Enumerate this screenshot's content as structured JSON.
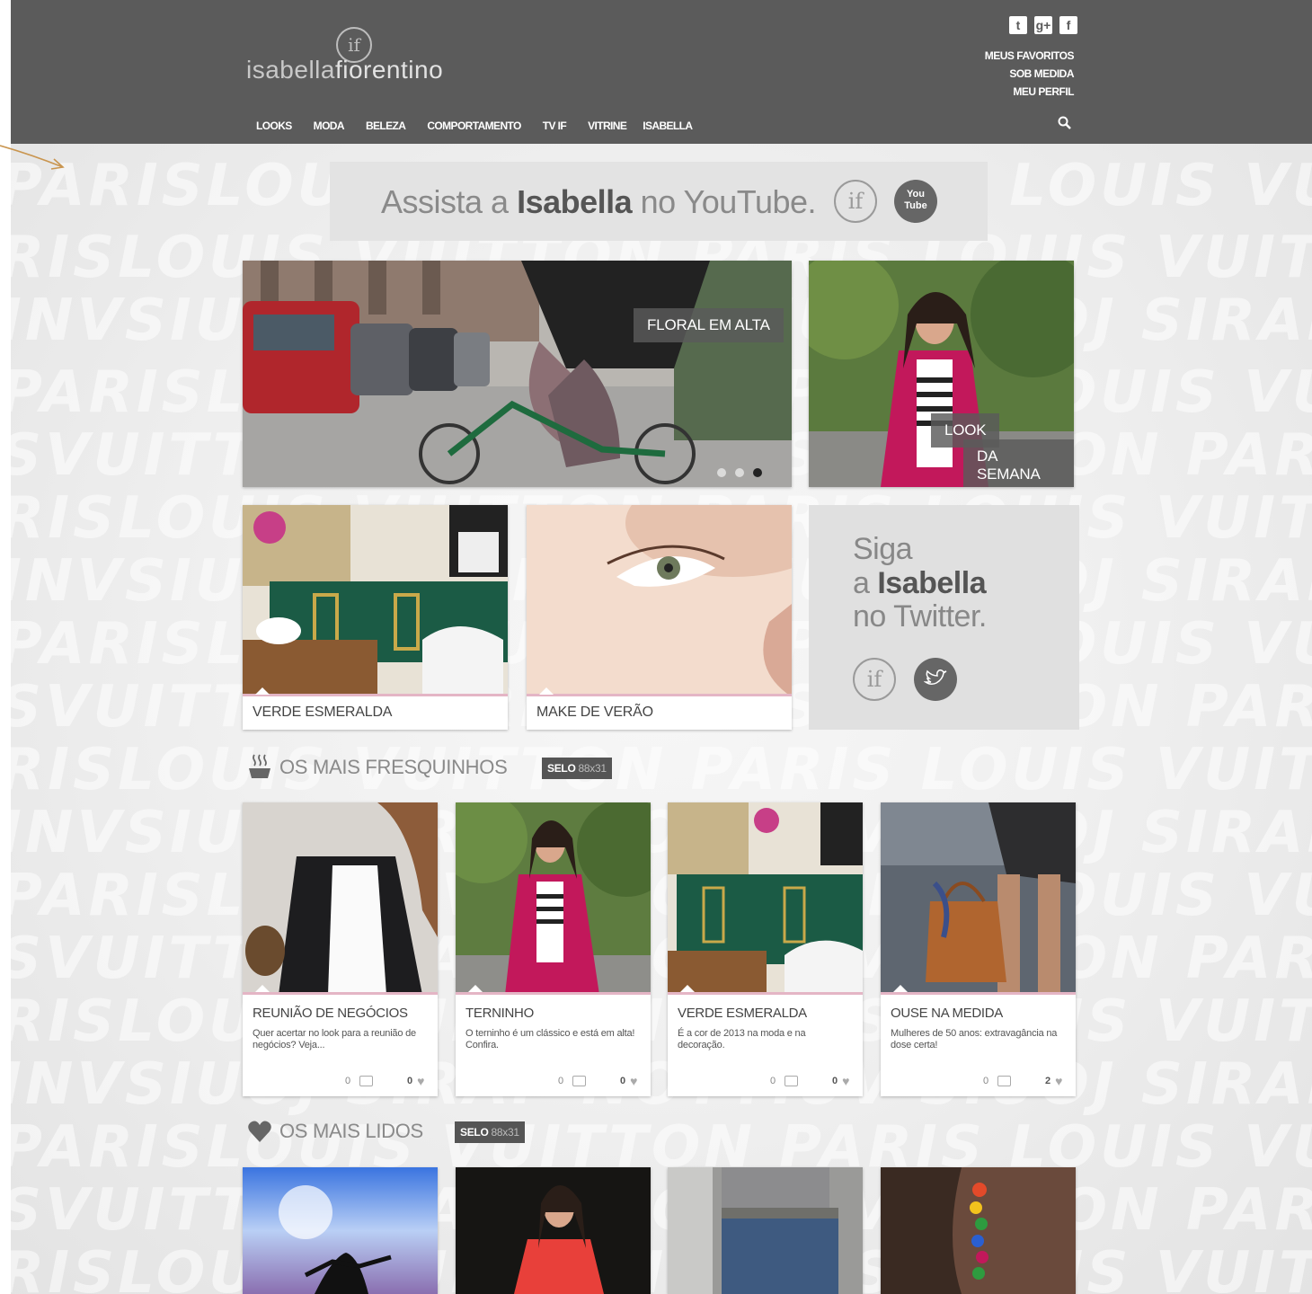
{
  "background": {
    "pattern_rows": [
      "PARISLOUIS VUITTON PARIS LOUIS VUITTON PARIS",
      "SVUITTON PARIS LOUIS VUITTON PARIS LOUIS",
      "RISLOUIS VUITTON PARIS LOUIS VUITTON PARIS",
      "INVSIUOJ SIRAP NOTTIUV SIUOJ SIRAP"
    ]
  },
  "header": {
    "logo_mark": "if",
    "logo_text_a": "isabella",
    "logo_text_b": "fiorentino",
    "social": [
      "t",
      "g+",
      "f"
    ],
    "user_links": [
      "MEUS FAVORITOS",
      "SOB MEDIDA",
      "MEU PERFIL"
    ],
    "nav": [
      "LOOKS",
      "MODA",
      "BELEZA",
      "COMPORTAMENTO",
      "TV IF",
      "VITRINE",
      "ISABELLA"
    ]
  },
  "youtube_banner": {
    "text_a": "Assista a ",
    "text_b": "Isabella",
    "text_c": " no YouTube.",
    "if_mark": "if",
    "yt_line1": "You",
    "yt_line2": "Tube"
  },
  "features": {
    "hero_caption": "FLORAL EM ALTA",
    "side_caption_1": "LOOK",
    "side_caption_2": "DA SEMANA",
    "card1": "VERDE ESMERALDA",
    "card2": "MAKE DE VERÃO"
  },
  "twitter_box": {
    "line1": "Siga",
    "line2a": "a ",
    "line2b": "Isabella",
    "line3": "no Twitter.",
    "if_mark": "if"
  },
  "fresquinhos": {
    "title": "OS MAIS FRESQUINHOS",
    "selo_a": "SELO ",
    "selo_b": "88x31",
    "posts": [
      {
        "title": "REUNIÃO DE NEGÓCIOS",
        "desc": "Quer acertar no look para a reunião de negócios? Veja...",
        "comments": "0",
        "likes": "0"
      },
      {
        "title": "TERNINHO",
        "desc": "O terninho é um clássico e está em alta! Confira.",
        "comments": "0",
        "likes": "0"
      },
      {
        "title": "VERDE ESMERALDA",
        "desc": "É a cor de 2013 na moda e na decoração.",
        "comments": "0",
        "likes": "0"
      },
      {
        "title": "OUSE NA MEDIDA",
        "desc": "Mulheres de 50 anos: extravagância na dose certa!",
        "comments": "0",
        "likes": "2"
      }
    ]
  },
  "lidos": {
    "title": "OS MAIS LIDOS",
    "selo_a": "SELO ",
    "selo_b": "88x31"
  },
  "colors": {
    "header_bg": "#5b5b5b",
    "accent_pink": "#c2185b",
    "card_bar": "#e4b5c5"
  }
}
